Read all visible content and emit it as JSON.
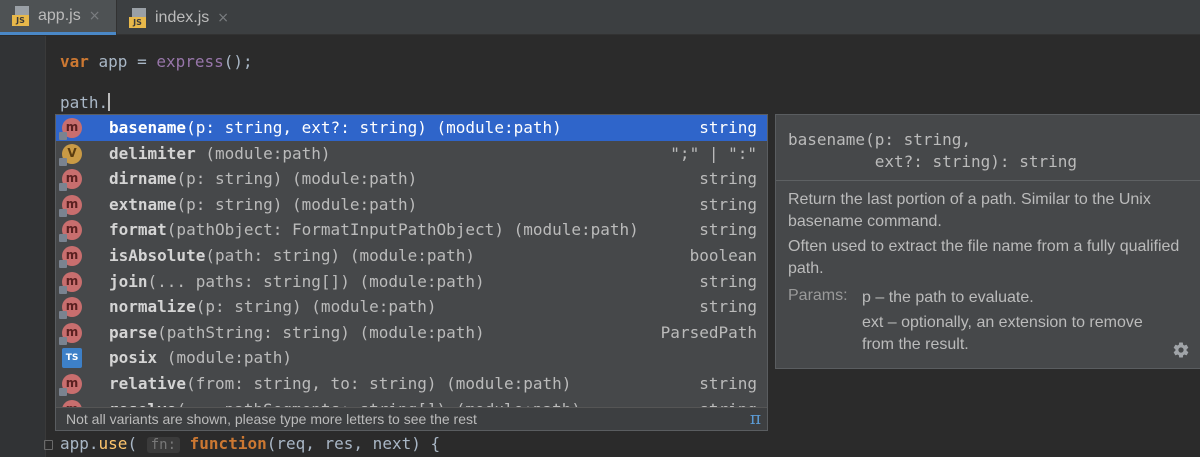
{
  "tabs": [
    {
      "label": "app.js",
      "badge": "JS",
      "close": "×",
      "active": true
    },
    {
      "label": "index.js",
      "badge": "JS",
      "close": "×",
      "active": false
    }
  ],
  "editor": {
    "line1": {
      "kw": "var",
      "ident": " app = ",
      "call": "express",
      "rest": "();"
    },
    "line2": {
      "text": "path."
    },
    "line3": {
      "obj": "app.",
      "method": "use",
      "open": "(",
      "hint": "fn:",
      "kw": "function",
      "params": "(req, res, next) {"
    }
  },
  "completion": {
    "items": [
      {
        "name": "basename",
        "args": "(p: string, ext?: string) (module:path)",
        "type": "string",
        "icon": "method-icon",
        "glyph": "m",
        "selected": true
      },
      {
        "name": "delimiter",
        "args": " (module:path)",
        "type": "\";\" | \":\"",
        "icon": "variable-icon",
        "glyph": "V",
        "selected": false
      },
      {
        "name": "dirname",
        "args": "(p: string) (module:path)",
        "type": "string",
        "icon": "method-icon",
        "glyph": "m",
        "selected": false
      },
      {
        "name": "extname",
        "args": "(p: string) (module:path)",
        "type": "string",
        "icon": "method-icon",
        "glyph": "m",
        "selected": false
      },
      {
        "name": "format",
        "args": "(pathObject: FormatInputPathObject) (module:path)",
        "type": "string",
        "icon": "method-icon",
        "glyph": "m",
        "selected": false
      },
      {
        "name": "isAbsolute",
        "args": "(path: string) (module:path)",
        "type": "boolean",
        "icon": "method-icon",
        "glyph": "m",
        "selected": false
      },
      {
        "name": "join",
        "args": "(... paths: string[]) (module:path)",
        "type": "string",
        "icon": "method-icon",
        "glyph": "m",
        "selected": false
      },
      {
        "name": "normalize",
        "args": "(p: string) (module:path)",
        "type": "string",
        "icon": "method-icon",
        "glyph": "m",
        "selected": false
      },
      {
        "name": "parse",
        "args": "(pathString: string) (module:path)",
        "type": "ParsedPath",
        "icon": "method-icon",
        "glyph": "m",
        "selected": false
      },
      {
        "name": "posix",
        "args": " (module:path)",
        "type": "",
        "icon": "typescript-icon",
        "glyph": "TS",
        "selected": false
      },
      {
        "name": "relative",
        "args": "(from: string, to: string) (module:path)",
        "type": "string",
        "icon": "method-icon",
        "glyph": "m",
        "selected": false
      },
      {
        "name": "resolve",
        "args": "(... pathSegments: string[]) (module:path)",
        "type": "string",
        "icon": "method-icon",
        "glyph": "m",
        "selected": false
      }
    ],
    "footer": "Not all variants are shown, please type more letters to see the rest",
    "footer_icon": "π"
  },
  "doc": {
    "signature_line1": "basename(p: string,",
    "signature_line2": "         ext?: string): string",
    "desc1": "Return the last portion of a path. Similar to the Unix basename command.",
    "desc2": "Often used to extract the file name from a fully qualified path.",
    "params_label": "Params:",
    "param1": "p – the path to evaluate.",
    "param2": "ext – optionally, an extension to remove from the result."
  },
  "colors": {
    "selection": "#2f65ca",
    "method_icon": "#c86e6e",
    "keyword": "#cc7832"
  }
}
